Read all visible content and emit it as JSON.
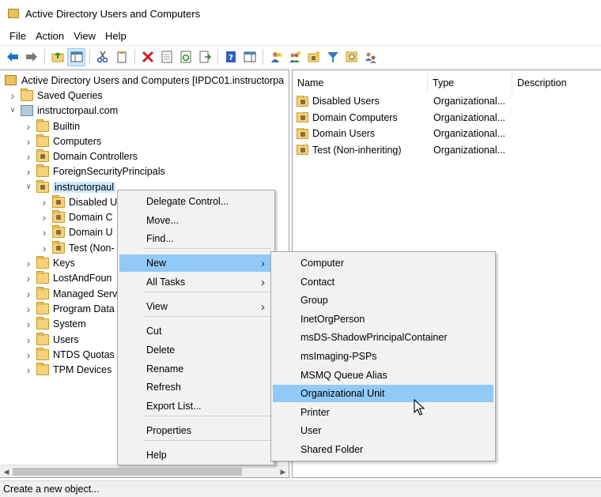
{
  "window": {
    "title": "Active Directory Users and Computers"
  },
  "menubar": [
    "File",
    "Action",
    "View",
    "Help"
  ],
  "toolbar": {
    "icons": [
      "back-arrow-icon",
      "forward-arrow-icon",
      "up-folder-icon",
      "show-console-tree-icon",
      "cut-icon",
      "copy-icon",
      "delete-icon",
      "properties-icon",
      "refresh-icon",
      "export-list-icon",
      "help-icon",
      "show-action-pane-icon",
      "new-user-icon",
      "new-group-icon",
      "new-ou-icon",
      "filter-icon",
      "find-icon",
      "delegate-icon"
    ]
  },
  "tree": {
    "root": "Active Directory Users and Computers [IPDC01.instructorpa",
    "nodes": [
      {
        "label": "Saved Queries",
        "level": 1,
        "expander": ">"
      },
      {
        "label": "instructorpaul.com",
        "level": 1,
        "expander": "v"
      },
      {
        "label": "Builtin",
        "level": 2,
        "expander": ">"
      },
      {
        "label": "Computers",
        "level": 2,
        "expander": ">"
      },
      {
        "label": "Domain Controllers",
        "level": 2,
        "expander": ">"
      },
      {
        "label": "ForeignSecurityPrincipals",
        "level": 2,
        "expander": ">"
      },
      {
        "label": "instructorpaul",
        "level": 2,
        "expander": "v"
      },
      {
        "label": "Disabled U",
        "level": 3,
        "expander": ">"
      },
      {
        "label": "Domain C",
        "level": 3,
        "expander": ">"
      },
      {
        "label": "Domain U",
        "level": 3,
        "expander": ">"
      },
      {
        "label": "Test (Non-",
        "level": 3,
        "expander": ">"
      },
      {
        "label": "Keys",
        "level": 2,
        "expander": ">"
      },
      {
        "label": "LostAndFoun",
        "level": 2,
        "expander": ">"
      },
      {
        "label": "Managed Serv",
        "level": 2,
        "expander": ">"
      },
      {
        "label": "Program Data",
        "level": 2,
        "expander": ">"
      },
      {
        "label": "System",
        "level": 2,
        "expander": ">"
      },
      {
        "label": "Users",
        "level": 2,
        "expander": ">"
      },
      {
        "label": "NTDS Quotas",
        "level": 2,
        "expander": ">"
      },
      {
        "label": "TPM Devices",
        "level": 2,
        "expander": ">"
      }
    ]
  },
  "list": {
    "columns": [
      "Name",
      "Type",
      "Description"
    ],
    "rows": [
      {
        "name": "Disabled Users",
        "type": "Organizational...",
        "description": ""
      },
      {
        "name": "Domain Computers",
        "type": "Organizational...",
        "description": ""
      },
      {
        "name": "Domain Users",
        "type": "Organizational...",
        "description": ""
      },
      {
        "name": "Test (Non-inheriting)",
        "type": "Organizational...",
        "description": ""
      }
    ]
  },
  "context_menu": {
    "items": [
      {
        "label": "Delegate Control...",
        "submenu": false
      },
      {
        "label": "Move...",
        "submenu": false
      },
      {
        "label": "Find...",
        "submenu": false
      },
      {
        "label": "New",
        "submenu": true,
        "active": true
      },
      {
        "label": "All Tasks",
        "submenu": true
      },
      {
        "label": "View",
        "submenu": true
      },
      {
        "label": "Cut",
        "submenu": false
      },
      {
        "label": "Delete",
        "submenu": false
      },
      {
        "label": "Rename",
        "submenu": false
      },
      {
        "label": "Refresh",
        "submenu": false
      },
      {
        "label": "Export List...",
        "submenu": false
      },
      {
        "label": "Properties",
        "submenu": false
      },
      {
        "label": "Help",
        "submenu": false
      }
    ]
  },
  "new_submenu": {
    "items": [
      "Computer",
      "Contact",
      "Group",
      "InetOrgPerson",
      "msDS-ShadowPrincipalContainer",
      "msImaging-PSPs",
      "MSMQ Queue Alias",
      "Organizational Unit",
      "Printer",
      "User",
      "Shared Folder"
    ],
    "active": "Organizational Unit"
  },
  "statusbar": {
    "text": "Create a new object..."
  },
  "colors": {
    "highlight": "#91c9f7",
    "selection": "#cce8ff",
    "menu_bg": "#f2f2f2"
  }
}
